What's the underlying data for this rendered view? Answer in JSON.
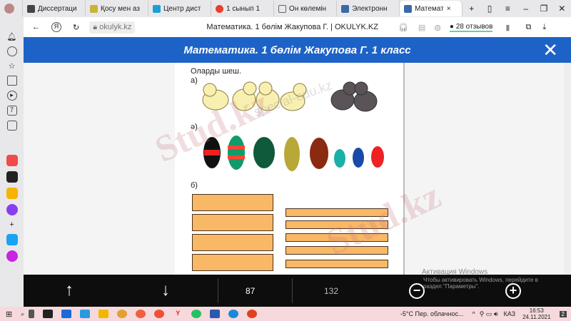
{
  "tabs": [
    {
      "label": "Диссертаци",
      "color": "#444"
    },
    {
      "label": "Қосу мен аз",
      "color": "#c8b43a"
    },
    {
      "label": "Центр дист",
      "color": "#1aa0d8"
    },
    {
      "label": "1 сынып 1",
      "color": "#e8402a"
    },
    {
      "label": "Он көлемін",
      "color": "#666"
    },
    {
      "label": "Электронн",
      "color": "#3a6aa8"
    },
    {
      "label": "Математ",
      "color": "#3a6aa8",
      "active": true
    }
  ],
  "address": {
    "url": "okulyk.kz",
    "title": "Математика. 1 бөлім Жакупова Г. | OKULYK.KZ",
    "reviews": "28 отзывов"
  },
  "header": {
    "title": "Математика. 1 бөлім Жакупова Г. 1 класс"
  },
  "page": {
    "instruction": "Оларды шеш.",
    "label_a": "а)",
    "label_ae": "ә)",
    "label_b": "б)"
  },
  "watermarks": {
    "site1": "Stud.kz",
    "site2": "special-edu.kz"
  },
  "bottom": {
    "current_page": "87",
    "total_pages": "132"
  },
  "activation": {
    "title": "Активация Windows",
    "text": "Чтобы активировать Windows, перейдите в раздел \"Параметры\"."
  },
  "taskbar": {
    "weather": "-5°C  Пер. облачнос...",
    "lang": "КАЗ",
    "time": "16:53",
    "date": "24.11.2021",
    "notif": "2"
  }
}
